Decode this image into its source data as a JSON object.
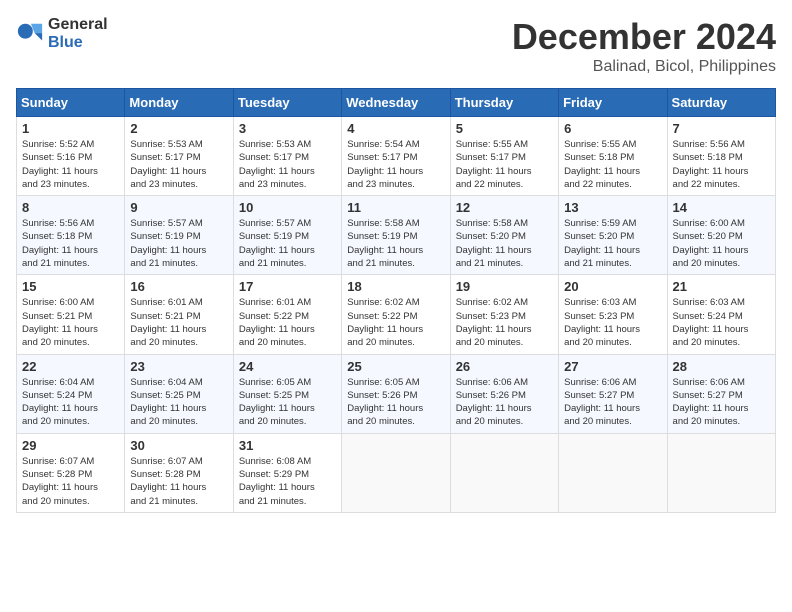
{
  "header": {
    "logo_general": "General",
    "logo_blue": "Blue",
    "month_title": "December 2024",
    "location": "Balinad, Bicol, Philippines"
  },
  "days_of_week": [
    "Sunday",
    "Monday",
    "Tuesday",
    "Wednesday",
    "Thursday",
    "Friday",
    "Saturday"
  ],
  "weeks": [
    [
      {
        "day": "1",
        "info": "Sunrise: 5:52 AM\nSunset: 5:16 PM\nDaylight: 11 hours\nand 23 minutes."
      },
      {
        "day": "2",
        "info": "Sunrise: 5:53 AM\nSunset: 5:17 PM\nDaylight: 11 hours\nand 23 minutes."
      },
      {
        "day": "3",
        "info": "Sunrise: 5:53 AM\nSunset: 5:17 PM\nDaylight: 11 hours\nand 23 minutes."
      },
      {
        "day": "4",
        "info": "Sunrise: 5:54 AM\nSunset: 5:17 PM\nDaylight: 11 hours\nand 23 minutes."
      },
      {
        "day": "5",
        "info": "Sunrise: 5:55 AM\nSunset: 5:17 PM\nDaylight: 11 hours\nand 22 minutes."
      },
      {
        "day": "6",
        "info": "Sunrise: 5:55 AM\nSunset: 5:18 PM\nDaylight: 11 hours\nand 22 minutes."
      },
      {
        "day": "7",
        "info": "Sunrise: 5:56 AM\nSunset: 5:18 PM\nDaylight: 11 hours\nand 22 minutes."
      }
    ],
    [
      {
        "day": "8",
        "info": "Sunrise: 5:56 AM\nSunset: 5:18 PM\nDaylight: 11 hours\nand 21 minutes."
      },
      {
        "day": "9",
        "info": "Sunrise: 5:57 AM\nSunset: 5:19 PM\nDaylight: 11 hours\nand 21 minutes."
      },
      {
        "day": "10",
        "info": "Sunrise: 5:57 AM\nSunset: 5:19 PM\nDaylight: 11 hours\nand 21 minutes."
      },
      {
        "day": "11",
        "info": "Sunrise: 5:58 AM\nSunset: 5:19 PM\nDaylight: 11 hours\nand 21 minutes."
      },
      {
        "day": "12",
        "info": "Sunrise: 5:58 AM\nSunset: 5:20 PM\nDaylight: 11 hours\nand 21 minutes."
      },
      {
        "day": "13",
        "info": "Sunrise: 5:59 AM\nSunset: 5:20 PM\nDaylight: 11 hours\nand 21 minutes."
      },
      {
        "day": "14",
        "info": "Sunrise: 6:00 AM\nSunset: 5:20 PM\nDaylight: 11 hours\nand 20 minutes."
      }
    ],
    [
      {
        "day": "15",
        "info": "Sunrise: 6:00 AM\nSunset: 5:21 PM\nDaylight: 11 hours\nand 20 minutes."
      },
      {
        "day": "16",
        "info": "Sunrise: 6:01 AM\nSunset: 5:21 PM\nDaylight: 11 hours\nand 20 minutes."
      },
      {
        "day": "17",
        "info": "Sunrise: 6:01 AM\nSunset: 5:22 PM\nDaylight: 11 hours\nand 20 minutes."
      },
      {
        "day": "18",
        "info": "Sunrise: 6:02 AM\nSunset: 5:22 PM\nDaylight: 11 hours\nand 20 minutes."
      },
      {
        "day": "19",
        "info": "Sunrise: 6:02 AM\nSunset: 5:23 PM\nDaylight: 11 hours\nand 20 minutes."
      },
      {
        "day": "20",
        "info": "Sunrise: 6:03 AM\nSunset: 5:23 PM\nDaylight: 11 hours\nand 20 minutes."
      },
      {
        "day": "21",
        "info": "Sunrise: 6:03 AM\nSunset: 5:24 PM\nDaylight: 11 hours\nand 20 minutes."
      }
    ],
    [
      {
        "day": "22",
        "info": "Sunrise: 6:04 AM\nSunset: 5:24 PM\nDaylight: 11 hours\nand 20 minutes."
      },
      {
        "day": "23",
        "info": "Sunrise: 6:04 AM\nSunset: 5:25 PM\nDaylight: 11 hours\nand 20 minutes."
      },
      {
        "day": "24",
        "info": "Sunrise: 6:05 AM\nSunset: 5:25 PM\nDaylight: 11 hours\nand 20 minutes."
      },
      {
        "day": "25",
        "info": "Sunrise: 6:05 AM\nSunset: 5:26 PM\nDaylight: 11 hours\nand 20 minutes."
      },
      {
        "day": "26",
        "info": "Sunrise: 6:06 AM\nSunset: 5:26 PM\nDaylight: 11 hours\nand 20 minutes."
      },
      {
        "day": "27",
        "info": "Sunrise: 6:06 AM\nSunset: 5:27 PM\nDaylight: 11 hours\nand 20 minutes."
      },
      {
        "day": "28",
        "info": "Sunrise: 6:06 AM\nSunset: 5:27 PM\nDaylight: 11 hours\nand 20 minutes."
      }
    ],
    [
      {
        "day": "29",
        "info": "Sunrise: 6:07 AM\nSunset: 5:28 PM\nDaylight: 11 hours\nand 20 minutes."
      },
      {
        "day": "30",
        "info": "Sunrise: 6:07 AM\nSunset: 5:28 PM\nDaylight: 11 hours\nand 21 minutes."
      },
      {
        "day": "31",
        "info": "Sunrise: 6:08 AM\nSunset: 5:29 PM\nDaylight: 11 hours\nand 21 minutes."
      },
      {
        "day": "",
        "info": ""
      },
      {
        "day": "",
        "info": ""
      },
      {
        "day": "",
        "info": ""
      },
      {
        "day": "",
        "info": ""
      }
    ]
  ]
}
